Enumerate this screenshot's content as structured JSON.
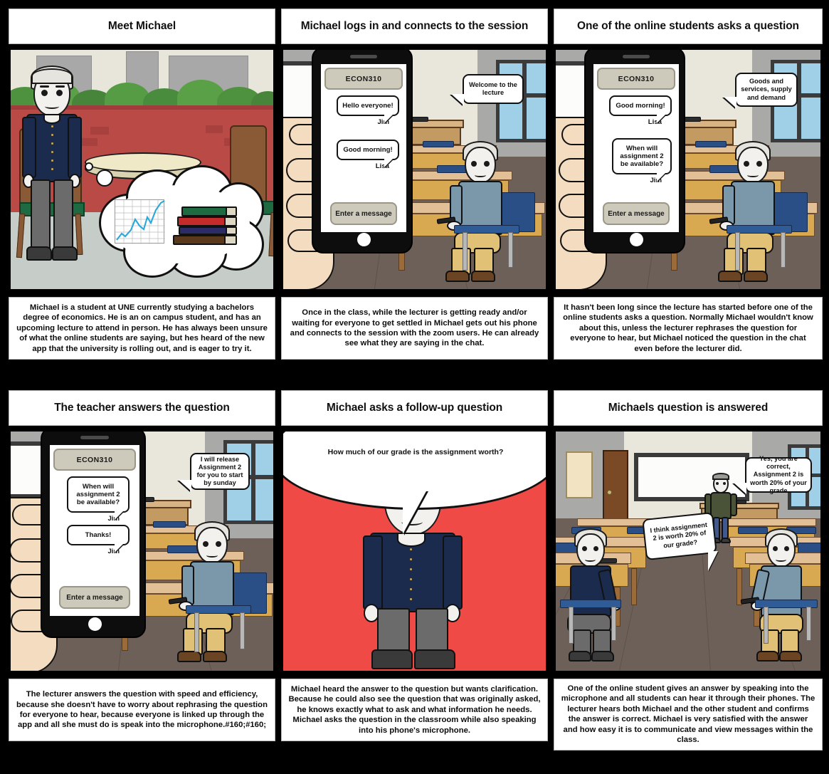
{
  "storyboard": {
    "panels": [
      {
        "id": "panel-1",
        "title": "Meet Michael",
        "caption": "Michael is a student at UNE currently studying a bachelors degree of economics. He is an on campus student, and has an upcoming lecture to attend in person. He has always been unsure of what the online students are saying, but hes heard of the new app that the university is rolling out, and is eager to try it.",
        "scene": "cafe-exterior-with-thought-bubble",
        "thought_bubble_contents": [
          "line-chart-icon",
          "stacked-books-icon"
        ]
      },
      {
        "id": "panel-2",
        "title": "Michael logs in and connects to the session",
        "caption": "Once in the class, while the lecturer is getting ready and/or waiting for everyone to get settled in Michael gets out his phone and connects to the session with the zoom users. He can already see what they are saying in the chat.",
        "scene": "classroom-with-phone",
        "phone": {
          "app_title": "ECON310",
          "messages": [
            {
              "text": "Hello everyone!",
              "sender": "Jim"
            },
            {
              "text": "Good morning!",
              "sender": "Lisa"
            }
          ],
          "input_placeholder": "Enter a message"
        },
        "speech_bubbles": [
          {
            "speaker": "lecturer",
            "text": "Welcome to the lecture"
          }
        ]
      },
      {
        "id": "panel-3",
        "title": "One of the online students asks a question",
        "caption": "It hasn't been long since the lecture has started before one of the online students asks a question. Normally Michael wouldn't know about this, unless the lecturer rephrases the question for everyone to hear, but Michael noticed the question in the chat even before the lecturer did.",
        "scene": "classroom-with-phone",
        "phone": {
          "app_title": "ECON310",
          "messages": [
            {
              "text": "Good morning!",
              "sender": "Lisa"
            },
            {
              "text": "When will assignment 2 be available?",
              "sender": "Jim"
            }
          ],
          "input_placeholder": "Enter a message"
        },
        "speech_bubbles": [
          {
            "speaker": "lecturer",
            "text": "Goods and services, supply and demand"
          }
        ]
      },
      {
        "id": "panel-4",
        "title": "The teacher answers the question",
        "caption": "The lecturer answers the question with speed and efficiency, because she doesn't have to worry about rephrasing the question for everyone to hear, because everyone is linked up through the app and all she must do is speak into the microphone.#160;#160;",
        "scene": "classroom-with-phone",
        "phone": {
          "app_title": "ECON310",
          "messages": [
            {
              "text": "When will assignment 2 be available?",
              "sender": "Jim"
            },
            {
              "text": "Thanks!",
              "sender": "Jim"
            }
          ],
          "input_placeholder": "Enter a message"
        },
        "speech_bubbles": [
          {
            "speaker": "lecturer",
            "text": "I will release Assignment 2 for you to start by sunday"
          }
        ]
      },
      {
        "id": "panel-5",
        "title": "Michael asks a follow-up question",
        "caption": "Michael heard the answer to the question but wants clarification. Because he could also see the question that was originally asked, he knows exactly what to ask and what information he needs. Michael asks the question in the classroom while also speaking into his phone's microphone.",
        "scene": "red-background-closeup",
        "background_color": "#f04a46",
        "speech_bubbles": [
          {
            "speaker": "michael",
            "text": "How much of our grade is the assignment worth?"
          }
        ]
      },
      {
        "id": "panel-6",
        "title": "Michaels question is answered",
        "caption": "One of the online student gives an answer by speaking into the microphone and all students can hear it through their phones. The lecturer hears both Michael and the other student and confirms the answer is correct. Michael is very satisfied with the answer and how easy it is to communicate and view messages within the class.",
        "scene": "classroom-two-students",
        "speech_bubbles": [
          {
            "speaker": "lecturer",
            "text": "Yes, you are correct, Assignment 2 is worth 20% of your grade"
          },
          {
            "speaker": "student",
            "text": "I think assignment 2 is worth 20% of our grade?"
          }
        ]
      }
    ]
  },
  "colors": {
    "board_background": "#000000",
    "panel_background": "#ffffff",
    "cafe_wall": "#b94a46",
    "cafe_hedge": "#4f9440",
    "classroom_floor": "#6d6058",
    "classroom_wall": "#e9e7dc",
    "phone_body": "#0d0d0d",
    "app_header": "#cdcabb",
    "red_panel": "#f04a46",
    "michael_shirt": "#1b2b4d",
    "student_shirt": "#7b98ab",
    "lecturer_jacket": "#4a5338"
  }
}
